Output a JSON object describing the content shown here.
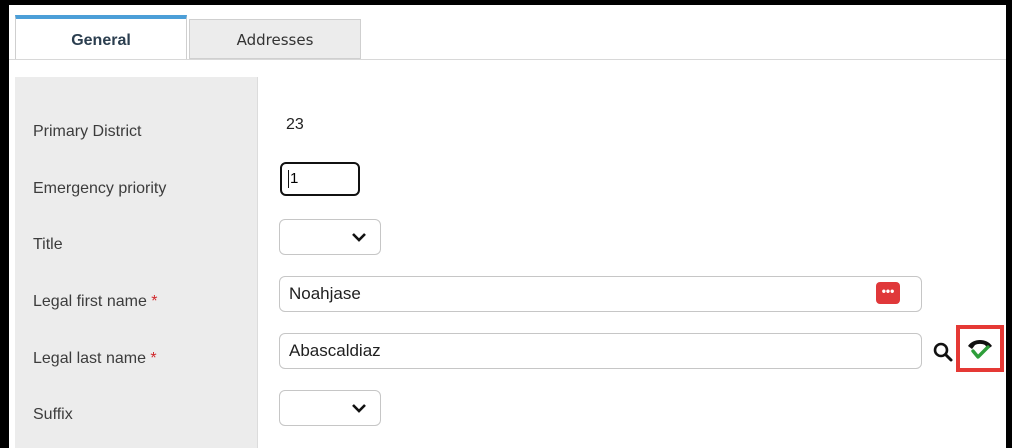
{
  "tabs": [
    {
      "label": "General",
      "active": true
    },
    {
      "label": "Addresses",
      "active": false
    }
  ],
  "form": {
    "primary_district": {
      "label": "Primary District",
      "value": "23"
    },
    "emergency_priority": {
      "label": "Emergency priority",
      "value": "1"
    },
    "title": {
      "label": "Title",
      "value": ""
    },
    "legal_first_name": {
      "label": "Legal first name",
      "required_mark": "*",
      "value": "Noahjase",
      "action_icon": "more-dots-icon",
      "action_label": "•••"
    },
    "legal_last_name": {
      "label": "Legal last name",
      "required_mark": "*",
      "value": "Abascaldiaz",
      "search_icon": "search-icon",
      "verify_icon": "phone-check-icon"
    },
    "suffix": {
      "label": "Suffix",
      "value": ""
    }
  },
  "colors": {
    "active_tab_accent": "#4c9fd8",
    "required": "#d0282b",
    "highlight_box": "#e53935",
    "check_green": "#2e9e3a",
    "dots_button": "#e0383a"
  }
}
